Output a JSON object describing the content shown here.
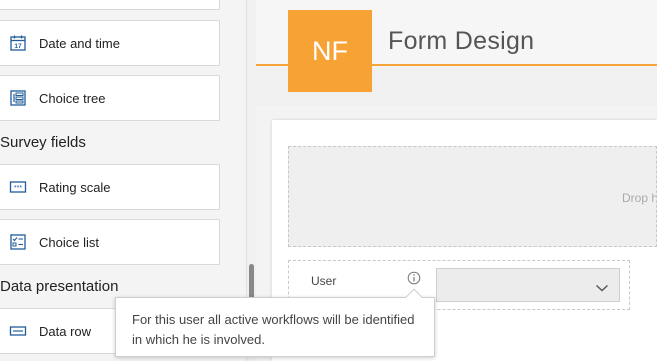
{
  "toolbox": {
    "items_top": [
      {
        "label": "",
        "icon": "field-icon"
      },
      {
        "label": "Date and time",
        "icon": "calendar-icon"
      },
      {
        "label": "Choice tree",
        "icon": "tree-icon"
      }
    ],
    "sections": [
      {
        "title": "Survey fields",
        "items": [
          {
            "label": "Rating scale",
            "icon": "rating-icon"
          },
          {
            "label": "Choice list",
            "icon": "checklist-icon"
          }
        ]
      },
      {
        "title": "Data presentation",
        "items": [
          {
            "label": "Data row",
            "icon": "datarow-icon"
          }
        ]
      }
    ]
  },
  "header": {
    "logo_text": "NF",
    "title": "Form Design",
    "accent_color": "#f7a234"
  },
  "form": {
    "drop_text": "Drop h",
    "field_label": "User",
    "select_value": ""
  },
  "tooltip": {
    "text": "For this user all active workflows will be identified in which he is involved."
  }
}
